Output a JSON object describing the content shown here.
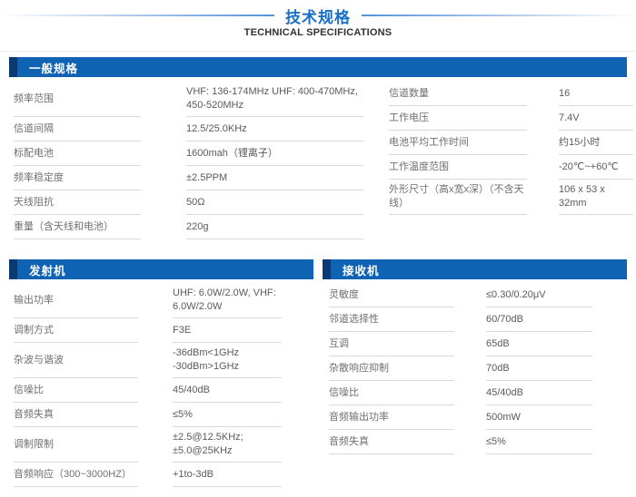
{
  "page": {
    "title_cn": "技术规格",
    "title_en": "TECHNICAL SPECIFICATIONS"
  },
  "colors": {
    "accent_blue": "#1062b3",
    "accent_dark_blue": "#0a3a73",
    "title_blue": "#1a70c6"
  },
  "general": {
    "title": "一般规格",
    "left_rows": [
      {
        "label": "频率范围",
        "value": "VHF: 136-174MHz UHF: 400-470MHz, 450-520MHz"
      },
      {
        "label": "信道间隔",
        "value": "12.5/25.0KHz"
      },
      {
        "label": "标配电池",
        "value": "1600mah（锂离子）"
      },
      {
        "label": "频率稳定度",
        "value": "±2.5PPM"
      },
      {
        "label": "天线阻抗",
        "value": "50Ω"
      },
      {
        "label": "重量（含天线和电池）",
        "value": "220g"
      }
    ],
    "right_rows": [
      {
        "label": "信道数量",
        "value": "16"
      },
      {
        "label": "工作电压",
        "value": "7.4V"
      },
      {
        "label": "电池平均工作时间",
        "value": "约15小时"
      },
      {
        "label": "工作温度范围",
        "value": "-20℃~+60℃"
      },
      {
        "label": "外形尺寸（高x宽x深）（不含天线）",
        "value": "106 x 53 x 32mm"
      }
    ]
  },
  "transmitter": {
    "title": "发射机",
    "rows": [
      {
        "label": "输出功率",
        "value": "UHF: 6.0W/2.0W, VHF: 6.0W/2.0W"
      },
      {
        "label": "调制方式",
        "value": "F3E"
      },
      {
        "label": "杂波与谐波",
        "value": "-36dBm<1GHz\n-30dBm>1GHz"
      },
      {
        "label": "信噪比",
        "value": "45/40dB"
      },
      {
        "label": "音频失真",
        "value": "≤5%"
      },
      {
        "label": "调制限制",
        "value": "±2.5@12.5KHz;\n±5.0@25KHz"
      },
      {
        "label": "音频响应（300~3000HZ）",
        "value": "+1to-3dB"
      }
    ]
  },
  "receiver": {
    "title": "接收机",
    "rows": [
      {
        "label": "灵敏度",
        "value": "≤0.30/0.20μV"
      },
      {
        "label": "邻道选择性",
        "value": "60/70dB"
      },
      {
        "label": "互调",
        "value": "65dB"
      },
      {
        "label": "杂散响应抑制",
        "value": "70dB"
      },
      {
        "label": "信噪比",
        "value": "45/40dB"
      },
      {
        "label": "音频输出功率",
        "value": "500mW"
      },
      {
        "label": "音频失真",
        "value": "≤5%"
      }
    ]
  }
}
